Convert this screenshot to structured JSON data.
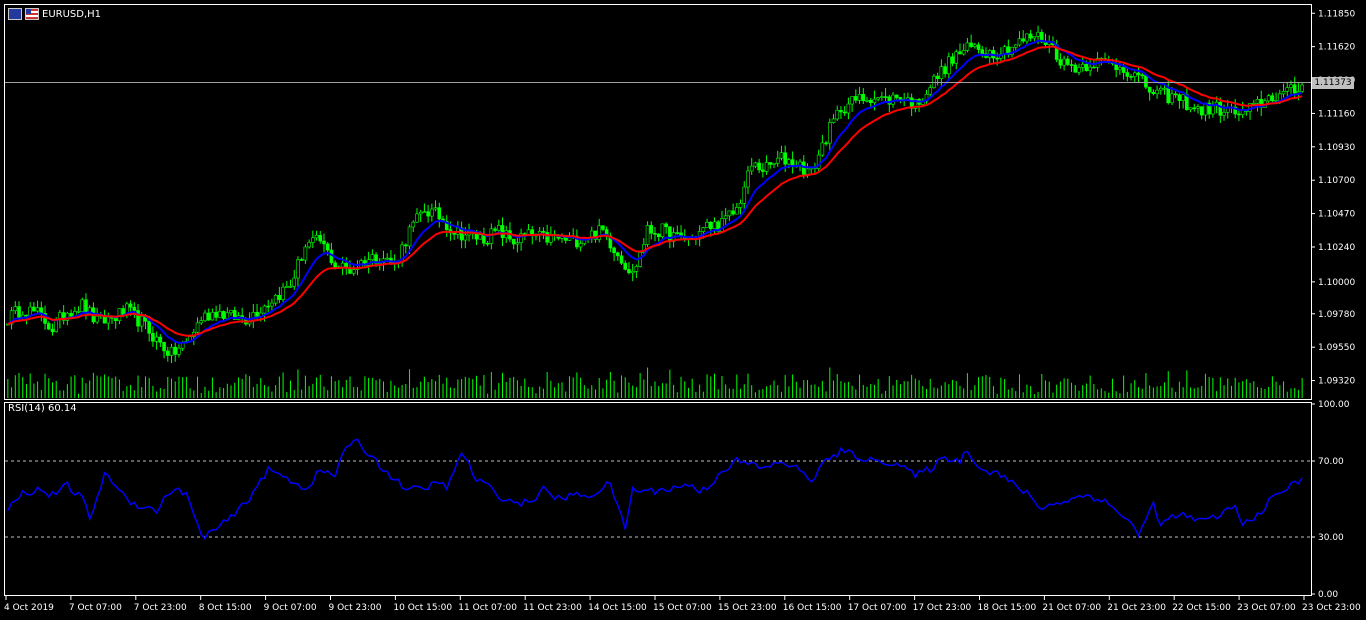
{
  "symbol": {
    "label": "EURUSD,H1",
    "flags": [
      "eu-flag-icon",
      "us-flag-icon"
    ]
  },
  "current_price": "1.11373",
  "rsi": {
    "label": "RSI(14) 60.14"
  },
  "colors": {
    "background": "#000000",
    "bull_candle": "#00ff00",
    "bear_candle": "#00ff00",
    "volume": "#00ff00",
    "fast_ma": "#0000ff",
    "slow_ma": "#ff0000",
    "rsi_line": "#0000ff",
    "grid_dashed": "#c0c0c0",
    "bid_line": "#a0a0a0"
  },
  "chart_data": [
    {
      "type": "candlestick",
      "title": "EURUSD,H1",
      "ylim": [
        1.092,
        1.119
      ],
      "ytick_labels": [
        "1.11850",
        "1.11620",
        "1.11390",
        "1.11160",
        "1.10930",
        "1.10700",
        "1.10470",
        "1.10240",
        "1.10000",
        "1.09780",
        "1.09550",
        "1.09320"
      ],
      "ytick_values": [
        1.1185,
        1.1162,
        1.1139,
        1.1116,
        1.1093,
        1.107,
        1.1047,
        1.1024,
        1.1,
        1.0978,
        1.0955,
        1.0932
      ],
      "x_tick_labels": [
        "4 Oct 2019",
        "7 Oct 07:00",
        "7 Oct 23:00",
        "8 Oct 15:00",
        "9 Oct 07:00",
        "9 Oct 23:00",
        "10 Oct 15:00",
        "11 Oct 07:00",
        "11 Oct 23:00",
        "14 Oct 15:00",
        "15 Oct 07:00",
        "15 Oct 23:00",
        "16 Oct 15:00",
        "17 Oct 07:00",
        "17 Oct 23:00",
        "18 Oct 15:00",
        "21 Oct 07:00",
        "21 Oct 23:00",
        "22 Oct 15:00",
        "23 Oct 07:00",
        "23 Oct 23:00"
      ],
      "close_path": [
        [
          0,
          1.0975
        ],
        [
          4,
          1.0982
        ],
        [
          8,
          1.0978
        ],
        [
          12,
          1.0968
        ],
        [
          16,
          1.098
        ],
        [
          20,
          1.0984
        ],
        [
          24,
          1.0972
        ],
        [
          28,
          1.0975
        ],
        [
          32,
          1.098
        ],
        [
          36,
          1.0972
        ],
        [
          40,
          1.096
        ],
        [
          44,
          1.095
        ],
        [
          48,
          1.0958
        ],
        [
          52,
          1.0975
        ],
        [
          56,
          1.098
        ],
        [
          60,
          1.0976
        ],
        [
          64,
          1.0975
        ],
        [
          68,
          1.0982
        ],
        [
          72,
          1.099
        ],
        [
          76,
          1.0998
        ],
        [
          80,
          1.1025
        ],
        [
          84,
          1.1028
        ],
        [
          88,
          1.1012
        ],
        [
          92,
          1.1008
        ],
        [
          96,
          1.1015
        ],
        [
          100,
          1.1018
        ],
        [
          104,
          1.1012
        ],
        [
          108,
          1.1035
        ],
        [
          112,
          1.105
        ],
        [
          116,
          1.1045
        ],
        [
          120,
          1.1035
        ],
        [
          124,
          1.1032
        ],
        [
          128,
          1.103
        ],
        [
          132,
          1.1035
        ],
        [
          136,
          1.1028
        ],
        [
          140,
          1.1032
        ],
        [
          144,
          1.103
        ],
        [
          148,
          1.103
        ],
        [
          152,
          1.1028
        ],
        [
          156,
          1.1032
        ],
        [
          160,
          1.1035
        ],
        [
          164,
          1.102
        ],
        [
          168,
          1.1005
        ],
        [
          172,
          1.1035
        ],
        [
          176,
          1.1035
        ],
        [
          180,
          1.103
        ],
        [
          184,
          1.103
        ],
        [
          188,
          1.1038
        ],
        [
          192,
          1.104
        ],
        [
          196,
          1.105
        ],
        [
          200,
          1.108
        ],
        [
          204,
          1.1078
        ],
        [
          208,
          1.1085
        ],
        [
          212,
          1.1082
        ],
        [
          216,
          1.1075
        ],
        [
          220,
          1.11
        ],
        [
          224,
          1.112
        ],
        [
          228,
          1.1125
        ],
        [
          232,
          1.1128
        ],
        [
          236,
          1.1125
        ],
        [
          240,
          1.1128
        ],
        [
          244,
          1.1122
        ],
        [
          248,
          1.1135
        ],
        [
          252,
          1.1148
        ],
        [
          256,
          1.1158
        ],
        [
          260,
          1.1162
        ],
        [
          264,
          1.1158
        ],
        [
          268,
          1.116
        ],
        [
          272,
          1.1165
        ],
        [
          276,
          1.117
        ],
        [
          280,
          1.1165
        ],
        [
          284,
          1.115
        ],
        [
          288,
          1.1148
        ],
        [
          292,
          1.1152
        ],
        [
          296,
          1.115
        ],
        [
          300,
          1.1148
        ],
        [
          304,
          1.114
        ],
        [
          308,
          1.113
        ],
        [
          312,
          1.1128
        ],
        [
          316,
          1.1125
        ],
        [
          320,
          1.1118
        ],
        [
          324,
          1.112
        ],
        [
          328,
          1.1118
        ],
        [
          332,
          1.1115
        ],
        [
          336,
          1.1122
        ],
        [
          340,
          1.1128
        ],
        [
          344,
          1.113
        ],
        [
          348,
          1.1134
        ]
      ],
      "bars_count": 349,
      "series": [
        {
          "type": "candles",
          "color": "#00ff00"
        },
        {
          "type": "moving-average",
          "color": "#0000ff"
        },
        {
          "type": "moving-average",
          "color": "#ff0000"
        },
        {
          "type": "volume-histogram",
          "color": "#00ff00"
        }
      ]
    },
    {
      "type": "line",
      "title": "RSI(14) 60.14",
      "ylim": [
        0,
        100
      ],
      "ytick_labels": [
        "100.00",
        "70.00",
        "30.00",
        "0.00"
      ],
      "ytick_values": [
        100,
        70,
        30,
        0
      ],
      "levels": [
        70,
        30
      ],
      "points": [
        [
          0,
          45
        ],
        [
          4,
          53
        ],
        [
          8,
          55
        ],
        [
          12,
          52
        ],
        [
          16,
          57
        ],
        [
          20,
          50
        ],
        [
          22,
          40
        ],
        [
          26,
          62
        ],
        [
          28,
          60
        ],
        [
          32,
          50
        ],
        [
          36,
          46
        ],
        [
          40,
          44
        ],
        [
          44,
          55
        ],
        [
          48,
          53
        ],
        [
          52,
          30
        ],
        [
          56,
          34
        ],
        [
          60,
          40
        ],
        [
          64,
          48
        ],
        [
          68,
          60
        ],
        [
          70,
          65
        ],
        [
          74,
          62
        ],
        [
          78,
          58
        ],
        [
          80,
          55
        ],
        [
          84,
          65
        ],
        [
          88,
          62
        ],
        [
          90,
          75
        ],
        [
          94,
          80
        ],
        [
          96,
          76
        ],
        [
          100,
          68
        ],
        [
          104,
          60
        ],
        [
          108,
          55
        ],
        [
          112,
          55
        ],
        [
          116,
          60
        ],
        [
          118,
          54
        ],
        [
          120,
          65
        ],
        [
          122,
          75
        ],
        [
          126,
          60
        ],
        [
          128,
          58
        ],
        [
          132,
          52
        ],
        [
          136,
          48
        ],
        [
          140,
          48
        ],
        [
          144,
          55
        ],
        [
          148,
          50
        ],
        [
          152,
          52
        ],
        [
          156,
          52
        ],
        [
          160,
          55
        ],
        [
          162,
          59
        ],
        [
          164,
          45
        ],
        [
          166,
          35
        ],
        [
          168,
          55
        ],
        [
          172,
          54
        ],
        [
          176,
          55
        ],
        [
          180,
          56
        ],
        [
          184,
          58
        ],
        [
          186,
          53
        ],
        [
          190,
          60
        ],
        [
          192,
          65
        ],
        [
          196,
          70
        ],
        [
          200,
          68
        ],
        [
          204,
          66
        ],
        [
          208,
          70
        ],
        [
          212,
          66
        ],
        [
          216,
          60
        ],
        [
          220,
          70
        ],
        [
          224,
          75
        ],
        [
          228,
          73
        ],
        [
          232,
          70
        ],
        [
          236,
          70
        ],
        [
          240,
          68
        ],
        [
          244,
          62
        ],
        [
          248,
          66
        ],
        [
          252,
          72
        ],
        [
          256,
          70
        ],
        [
          258,
          76
        ],
        [
          262,
          65
        ],
        [
          266,
          64
        ],
        [
          270,
          58
        ],
        [
          274,
          53
        ],
        [
          278,
          45
        ],
        [
          282,
          48
        ],
        [
          286,
          50
        ],
        [
          290,
          52
        ],
        [
          294,
          50
        ],
        [
          298,
          44
        ],
        [
          302,
          38
        ],
        [
          304,
          30
        ],
        [
          308,
          48
        ],
        [
          310,
          36
        ],
        [
          314,
          42
        ],
        [
          318,
          40
        ],
        [
          322,
          38
        ],
        [
          326,
          42
        ],
        [
          330,
          46
        ],
        [
          332,
          36
        ],
        [
          336,
          42
        ],
        [
          340,
          50
        ],
        [
          344,
          56
        ],
        [
          348,
          60
        ]
      ]
    }
  ]
}
